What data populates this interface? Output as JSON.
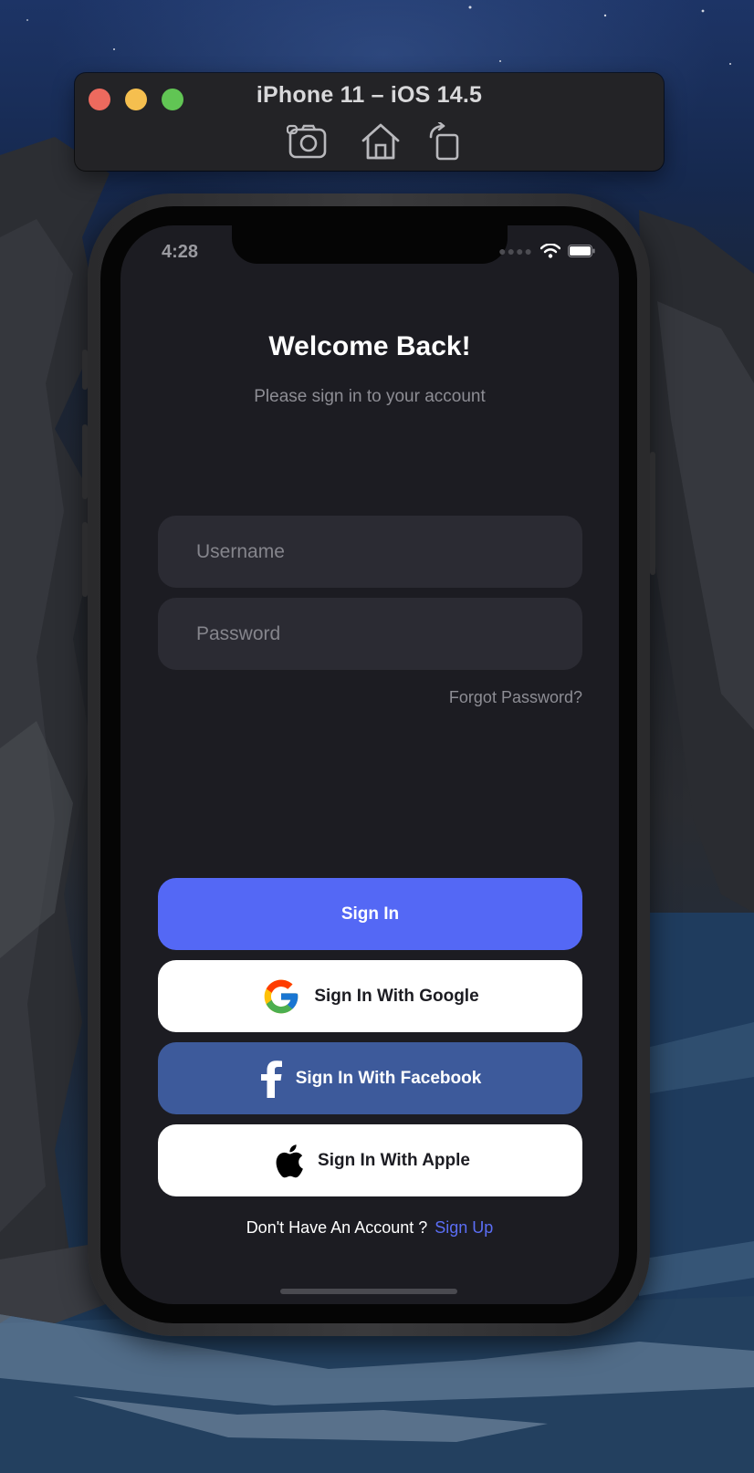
{
  "simulator": {
    "title": "iPhone 11 – iOS 14.5",
    "tools": [
      "screenshot-icon",
      "home-icon",
      "rotate-icon"
    ],
    "traffic_lights": {
      "close": "#ed6a5e",
      "minimize": "#f5bf4f",
      "zoom": "#61c554"
    }
  },
  "status_bar": {
    "time": "4:28",
    "icons": [
      "cellular-dots-icon",
      "wifi-icon",
      "battery-icon"
    ]
  },
  "login": {
    "title": "Welcome Back!",
    "subtitle": "Please sign in to your account",
    "username_placeholder": "Username",
    "password_placeholder": "Password",
    "forgot_password": "Forgot Password?",
    "sign_in": "Sign In",
    "sign_in_google": "Sign In With Google",
    "sign_in_facebook": "Sign In With Facebook",
    "sign_in_apple": "Sign In With Apple",
    "no_account_prompt": "Don't Have An Account ?",
    "sign_up": "Sign Up"
  },
  "colors": {
    "screen_background": "#1c1c22",
    "field_background": "#2b2b33",
    "primary_button": "#5468f5",
    "facebook_button": "#3d5a9b",
    "link": "#5b6ef5"
  }
}
